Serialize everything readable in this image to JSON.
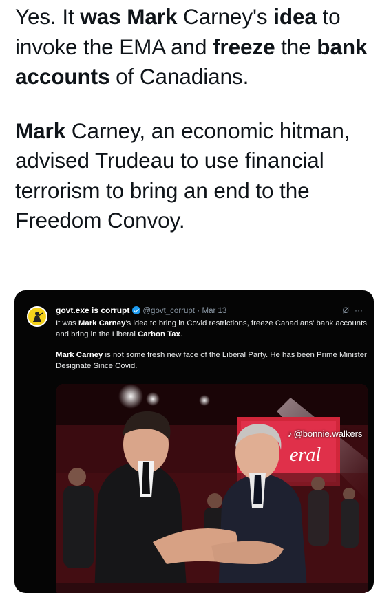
{
  "post": {
    "para1": [
      {
        "text": "Yes. It ",
        "bold": false
      },
      {
        "text": "was Mark",
        "bold": true
      },
      {
        "text": " Carney's ",
        "bold": false
      },
      {
        "text": "idea",
        "bold": true
      },
      {
        "text": " to invoke the EMA and ",
        "bold": false
      },
      {
        "text": "freeze",
        "bold": true
      },
      {
        "text": " the ",
        "bold": false
      },
      {
        "text": "bank accounts",
        "bold": true
      },
      {
        "text": " of Canadians.",
        "bold": false
      }
    ],
    "para2": [
      {
        "text": "Mark",
        "bold": true
      },
      {
        "text": " Carney, an economic hitman, advised Trudeau to use financial terrorism to bring an end to the Freedom Convoy.",
        "bold": false
      }
    ]
  },
  "quoted": {
    "display_name": "govt.exe is corrupt",
    "handle": "@govt_corrupt",
    "separator": "·",
    "date": "Mar 13",
    "grok_icon": "circle-slash-icon",
    "more_label": "···",
    "body1": [
      {
        "text": "It was ",
        "bold": false
      },
      {
        "text": "Mark Carney",
        "bold": true
      },
      {
        "text": "'s idea to bring in Covid restrictions, freeze Canadians' bank accounts and bring in the Liberal ",
        "bold": false
      },
      {
        "text": "Carbon",
        "bold": true
      },
      {
        "text": " ",
        "bold": false
      },
      {
        "text": "Tax",
        "bold": true
      },
      {
        "text": ".",
        "bold": false
      }
    ],
    "body2": [
      {
        "text": "Mark Carney",
        "bold": true
      },
      {
        "text": " is not some fresh new face of the Liberal Party. He has been Prime Minister Designate Since Covid.",
        "bold": false
      }
    ]
  },
  "photo": {
    "watermark_handle": "@bonnie.walkers",
    "watermark_logo": "tiktok-icon",
    "sign_text": "eral"
  }
}
